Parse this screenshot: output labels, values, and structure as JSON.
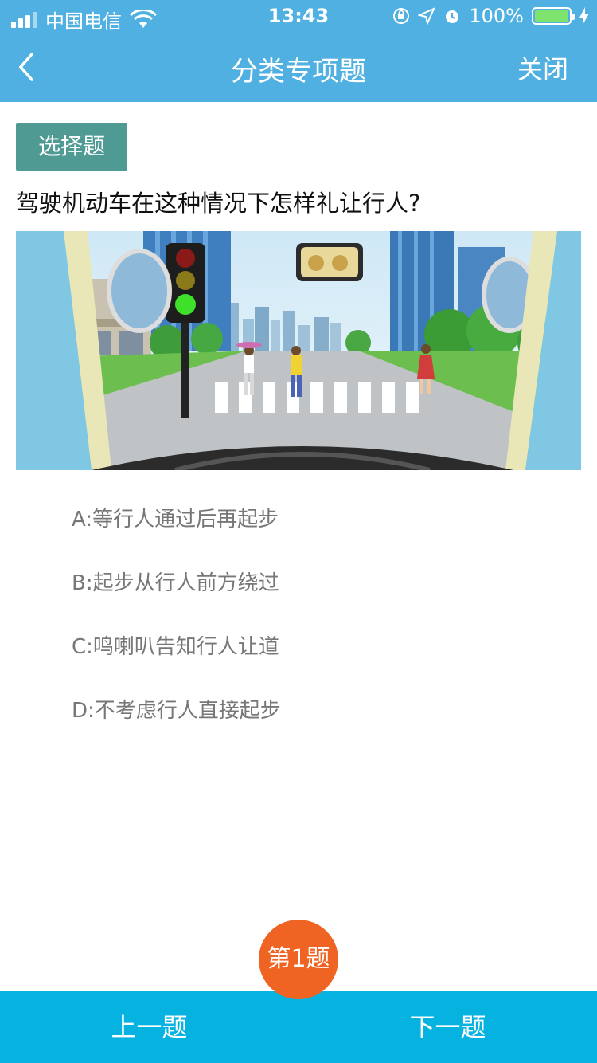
{
  "status_bar": {
    "carrier": "中国电信",
    "time": "13:43",
    "battery_percent": "100%",
    "battery_level": 1.0
  },
  "nav": {
    "title": "分类专项题",
    "close_label": "关闭",
    "back_icon": "chevron-left-icon"
  },
  "question": {
    "type_label": "选择题",
    "text": "驾驶机动车在这种情况下怎样礼让行人?",
    "options": [
      {
        "label": "A:等行人通过后再起步"
      },
      {
        "label": "B:起步从行人前方绕过"
      },
      {
        "label": "C:鸣喇叭告知行人让道"
      },
      {
        "label": "D:不考虑行人直接起步"
      }
    ]
  },
  "footer": {
    "prev_label": "上一题",
    "next_label": "下一题",
    "question_number_label": "第1题"
  },
  "colors": {
    "header_bg": "#4fb0e1",
    "badge_bg": "#4f9a93",
    "footer_bg": "#06b2e0",
    "number_badge_bg": "#f06423"
  }
}
